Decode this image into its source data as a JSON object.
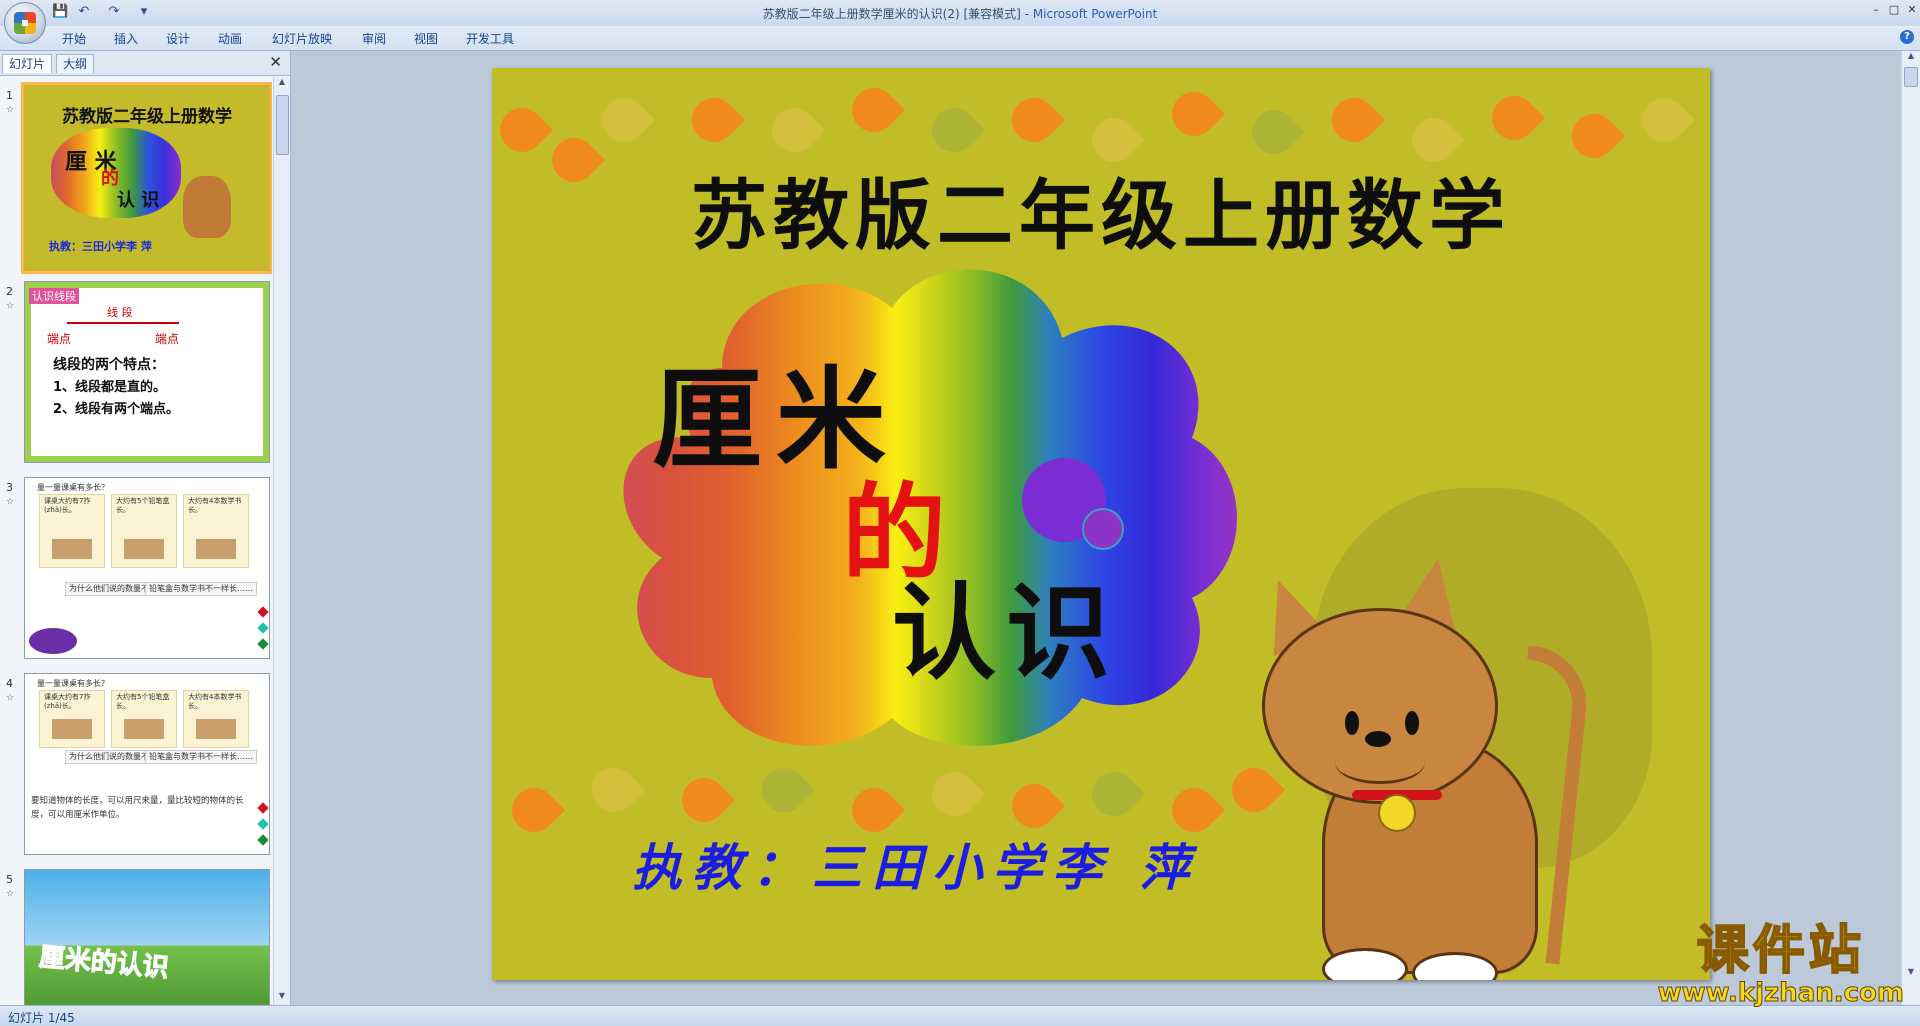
{
  "window": {
    "title": "苏教版二年级上册数学厘米的认识(2) [兼容模式]",
    "title_sep": " - ",
    "app_name": "Microsoft PowerPoint",
    "controls": [
      "–",
      "□",
      "✕"
    ]
  },
  "quick_access": {
    "icons": [
      "save-icon",
      "undo-icon",
      "redo-icon",
      "customize-icon"
    ],
    "glyphs": {
      "save": "💾",
      "undo": "↶",
      "redo": "↷",
      "customize": "▾"
    }
  },
  "ribbon": {
    "tabs": [
      "开始",
      "插入",
      "设计",
      "动画",
      "幻灯片放映",
      "审阅",
      "视图",
      "开发工具"
    ],
    "help": "?"
  },
  "left_pane": {
    "tabs": [
      "幻灯片",
      "大纲"
    ],
    "close_glyph": "✕",
    "thumbnails": [
      {
        "num": "1",
        "title": "苏教版二年级上册数学",
        "w1": "厘 米",
        "w2": "的",
        "w3": "认 识",
        "author": "执教：三田小学李 萍"
      },
      {
        "num": "2",
        "label": "认识线段",
        "segment": "线 段",
        "endpoint_l": "端点",
        "endpoint_r": "端点",
        "f1": "线段的两个特点：",
        "f2": "1、线段都是直的。",
        "f3": "2、线段有两个端点。"
      },
      {
        "num": "3",
        "header": "量一量课桌有多长？",
        "box1": "课桌大约有7拃(zhǎ)长。",
        "box2": "大约有5个铅笔盒长。",
        "box3": "大约有4本数学书长。",
        "q1": "为什么他们说的数量不相同？",
        "q2": "铅笔盒与数学书不一样长……"
      },
      {
        "num": "4",
        "header": "量一量课桌有多长？",
        "box1": "课桌大约有7拃(zhǎ)长。",
        "box2": "大约有5个铅笔盒长。",
        "box3": "大约有4本数学书长。",
        "q1": "为什么他们说的数量不相同？",
        "q2": "铅笔盒与数学书不一样长……",
        "note": "要知道物体的长度，可以用尺来量，量比较短的物体的长度，可以用厘米作单位。"
      },
      {
        "num": "5",
        "title": "厘米的认识"
      }
    ]
  },
  "slide": {
    "title": "苏教版二年级上册数学",
    "word_li": "厘米",
    "word_de": "的",
    "word_ren": "认识",
    "author": "执教：三田小学李 萍",
    "colors": {
      "background": "#c1bd27",
      "title": "#0e0e0e",
      "accent": "#e51212",
      "author": "#1b1ee0"
    }
  },
  "watermark": {
    "text": "课件站",
    "url": "www.kjzhan.com"
  },
  "status": {
    "text": "幻灯片 1/45"
  }
}
